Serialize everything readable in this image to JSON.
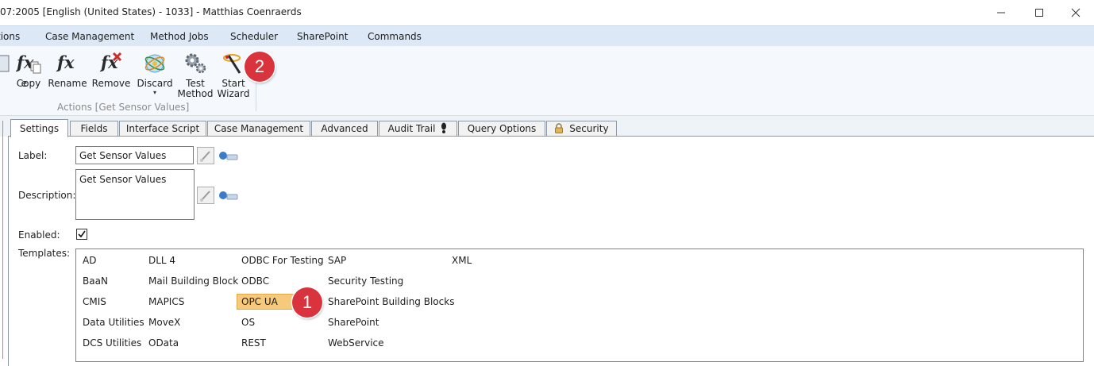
{
  "window": {
    "title": "07:2005 [English (United States) - 1033] - Matthias Coenraerds"
  },
  "menu": {
    "items": [
      "tions",
      "Case Management",
      "Method Jobs",
      "Scheduler",
      "SharePoint",
      "Commands"
    ]
  },
  "ribbon": {
    "buttons": [
      {
        "label": "e",
        "icon": "partial-icon"
      },
      {
        "label": "Copy",
        "icon": "fx-copy-icon"
      },
      {
        "label": "Rename",
        "icon": "fx-rename-icon"
      },
      {
        "label": "Remove",
        "icon": "fx-remove-icon"
      },
      {
        "label": "Discard",
        "icon": "atom-icon"
      },
      {
        "label": "Test\nMethod",
        "icon": "gears-icon"
      },
      {
        "label": "Start\nWizard",
        "icon": "wizard-wand-icon"
      }
    ],
    "group_label": "Actions [Get Sensor Values]"
  },
  "badges": {
    "one": "1",
    "two": "2"
  },
  "tabs": [
    {
      "label": "Settings",
      "active": true
    },
    {
      "label": "Fields"
    },
    {
      "label": "Interface Script"
    },
    {
      "label": "Case Management"
    },
    {
      "label": "Advanced"
    },
    {
      "label": "Audit Trail"
    },
    {
      "label": "Query Options"
    },
    {
      "label": "Security"
    }
  ],
  "form": {
    "label_caption": "Label:",
    "label_value": "Get Sensor Values",
    "description_caption": "Description:",
    "description_value": "Get Sensor Values",
    "enabled_caption": "Enabled:",
    "enabled_checked": true,
    "templates_caption": "Templates:"
  },
  "templates": {
    "columns": [
      [
        "AD",
        "BaaN",
        "CMIS",
        "Data Utilities",
        "DCS Utilities"
      ],
      [
        "DLL 4",
        "Mail Building Block",
        "MAPICS",
        "MoveX",
        "OData"
      ],
      [
        "ODBC For Testing",
        "ODBC",
        "OPC UA",
        "OS",
        "REST"
      ],
      [
        "SAP",
        "Security Testing",
        "SharePoint Building Blocks",
        "SharePoint",
        "WebService"
      ],
      [
        "XML"
      ]
    ],
    "selected": "OPC UA"
  },
  "colors": {
    "menubar": "#dce8f5",
    "selection": "#f7c97b",
    "badge": "#d9343d"
  }
}
